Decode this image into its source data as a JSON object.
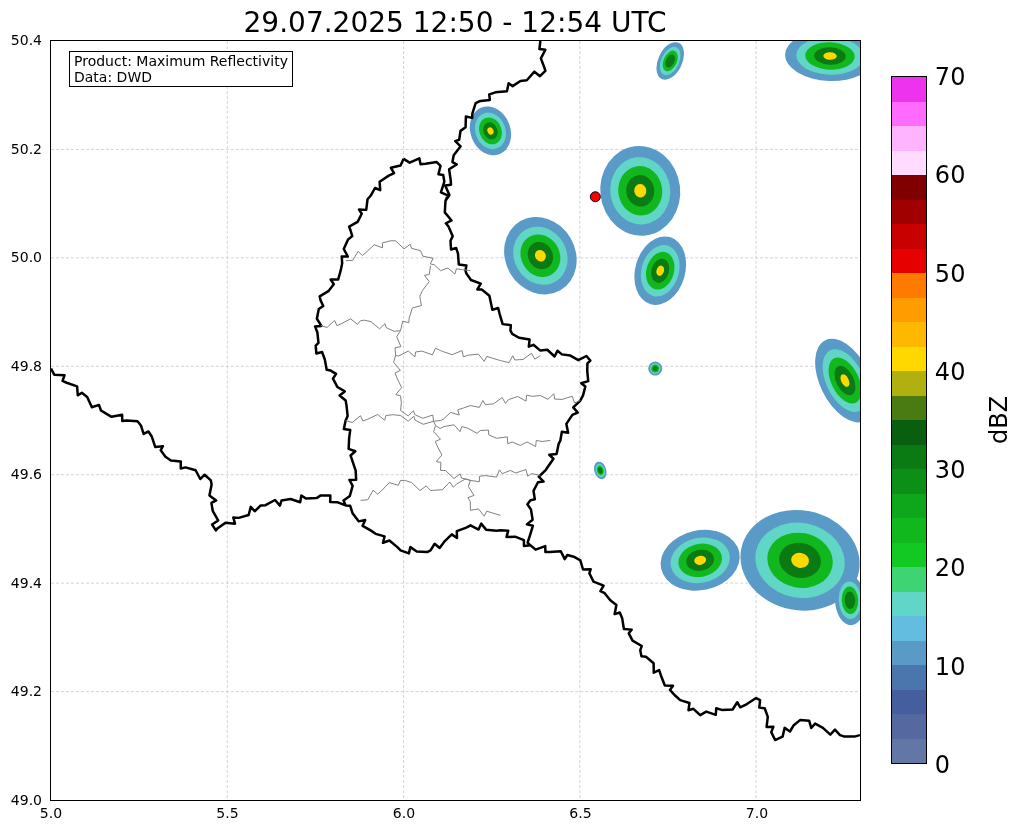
{
  "title": "29.07.2025 12:50 - 12:54 UTC",
  "info_box": [
    "Product: Maximum Reflectivity",
    "Data: DWD"
  ],
  "map": {
    "x_ticks": [
      "5.0",
      "5.5",
      "6.0",
      "6.5",
      "7.0"
    ],
    "y_ticks": [
      "50.4",
      "50.2",
      "50.0",
      "49.8",
      "49.6",
      "49.4",
      "49.2",
      "49.0"
    ]
  },
  "colorbar": {
    "label": "dBZ",
    "ticks": [
      "70",
      "60",
      "50",
      "40",
      "30",
      "20",
      "10",
      "0"
    ],
    "segments": [
      {
        "color": "#6377a6"
      },
      {
        "color": "#5568a0"
      },
      {
        "color": "#455f9e"
      },
      {
        "color": "#4b76ad"
      },
      {
        "color": "#5a9ac6"
      },
      {
        "color": "#63bde0"
      },
      {
        "color": "#61d5c6"
      },
      {
        "color": "#3ed373"
      },
      {
        "color": "#12c823"
      },
      {
        "color": "#10b81d"
      },
      {
        "color": "#0ea61a"
      },
      {
        "color": "#0c8f16"
      },
      {
        "color": "#0a7a13"
      },
      {
        "color": "#0a5e10"
      },
      {
        "color": "#4a7a12"
      },
      {
        "color": "#b0b010"
      },
      {
        "color": "#ffd800"
      },
      {
        "color": "#ffb800"
      },
      {
        "color": "#ff9c00"
      },
      {
        "color": "#ff7b00"
      },
      {
        "color": "#e60000"
      },
      {
        "color": "#c80000"
      },
      {
        "color": "#a00000"
      },
      {
        "color": "#800000"
      },
      {
        "color": "#ffdcff"
      },
      {
        "color": "#ffb4ff"
      },
      {
        "color": "#ff6aff"
      },
      {
        "color": "#ee33ee"
      }
    ]
  }
}
